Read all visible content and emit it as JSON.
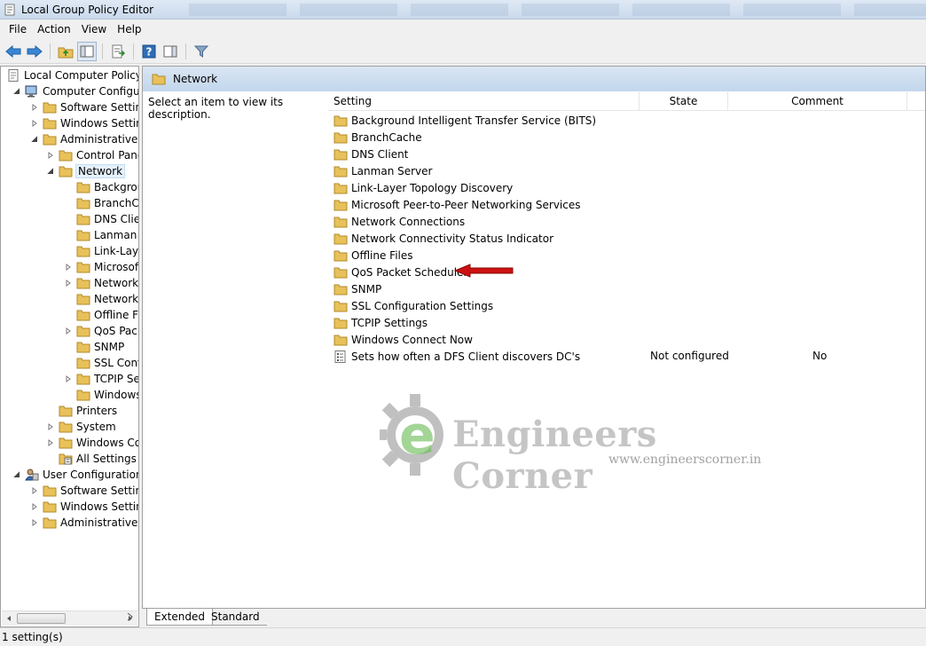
{
  "window": {
    "title": "Local Group Policy Editor"
  },
  "menu": [
    "File",
    "Action",
    "View",
    "Help"
  ],
  "tree": {
    "items": [
      {
        "label": "Local Computer Policy",
        "level": 0,
        "icon": "policy-icon",
        "expander": "none"
      },
      {
        "label": "Computer Configura",
        "level": 1,
        "icon": "computer-icon",
        "expander": "expanded"
      },
      {
        "label": "Software Settings",
        "level": 2,
        "icon": "folder-icon",
        "expander": "collapsed"
      },
      {
        "label": "Windows Setting",
        "level": 2,
        "icon": "folder-icon",
        "expander": "collapsed"
      },
      {
        "label": "Administrative Te",
        "level": 2,
        "icon": "folder-icon",
        "expander": "expanded"
      },
      {
        "label": "Control Panel",
        "level": 3,
        "icon": "folder-icon",
        "expander": "collapsed"
      },
      {
        "label": "Network",
        "level": 3,
        "icon": "folder-open-icon",
        "expander": "expanded",
        "selected": true
      },
      {
        "label": "Backgrou",
        "level": 4,
        "icon": "folder-icon",
        "expander": "none"
      },
      {
        "label": "BranchCa",
        "level": 4,
        "icon": "folder-icon",
        "expander": "none"
      },
      {
        "label": "DNS Clien",
        "level": 4,
        "icon": "folder-icon",
        "expander": "none"
      },
      {
        "label": "Lanman S",
        "level": 4,
        "icon": "folder-icon",
        "expander": "none"
      },
      {
        "label": "Link-Laye",
        "level": 4,
        "icon": "folder-icon",
        "expander": "none"
      },
      {
        "label": "Microsoft",
        "level": 4,
        "icon": "folder-icon",
        "expander": "collapsed"
      },
      {
        "label": "Network C",
        "level": 4,
        "icon": "folder-icon",
        "expander": "collapsed"
      },
      {
        "label": "Network C",
        "level": 4,
        "icon": "folder-icon",
        "expander": "none"
      },
      {
        "label": "Offline Fil",
        "level": 4,
        "icon": "folder-icon",
        "expander": "none"
      },
      {
        "label": "QoS Packe",
        "level": 4,
        "icon": "folder-icon",
        "expander": "collapsed"
      },
      {
        "label": "SNMP",
        "level": 4,
        "icon": "folder-icon",
        "expander": "none"
      },
      {
        "label": "SSL Confi",
        "level": 4,
        "icon": "folder-icon",
        "expander": "none"
      },
      {
        "label": "TCPIP Set",
        "level": 4,
        "icon": "folder-icon",
        "expander": "collapsed"
      },
      {
        "label": "Windows",
        "level": 4,
        "icon": "folder-icon",
        "expander": "none"
      },
      {
        "label": "Printers",
        "level": 3,
        "icon": "folder-icon",
        "expander": "none"
      },
      {
        "label": "System",
        "level": 3,
        "icon": "folder-icon",
        "expander": "collapsed"
      },
      {
        "label": "Windows Cor",
        "level": 3,
        "icon": "folder-icon",
        "expander": "collapsed"
      },
      {
        "label": "All Settings",
        "level": 3,
        "icon": "all-settings-icon",
        "expander": "none"
      },
      {
        "label": "User Configuration",
        "level": 1,
        "icon": "user-icon",
        "expander": "expanded"
      },
      {
        "label": "Software Settings",
        "level": 2,
        "icon": "folder-icon",
        "expander": "collapsed"
      },
      {
        "label": "Windows Setting",
        "level": 2,
        "icon": "folder-icon",
        "expander": "collapsed"
      },
      {
        "label": "Administrative Te",
        "level": 2,
        "icon": "folder-icon",
        "expander": "collapsed"
      }
    ]
  },
  "right": {
    "header_title": "Network",
    "description": "Select an item to view its description.",
    "columns": [
      "Setting",
      "State",
      "Comment"
    ],
    "rows": [
      {
        "name": "Background Intelligent Transfer Service (BITS)",
        "icon": "folder-icon",
        "state": "",
        "comment": ""
      },
      {
        "name": "BranchCache",
        "icon": "folder-icon",
        "state": "",
        "comment": ""
      },
      {
        "name": "DNS Client",
        "icon": "folder-icon",
        "state": "",
        "comment": ""
      },
      {
        "name": "Lanman Server",
        "icon": "folder-icon",
        "state": "",
        "comment": ""
      },
      {
        "name": "Link-Layer Topology Discovery",
        "icon": "folder-icon",
        "state": "",
        "comment": ""
      },
      {
        "name": "Microsoft Peer-to-Peer Networking Services",
        "icon": "folder-icon",
        "state": "",
        "comment": ""
      },
      {
        "name": "Network Connections",
        "icon": "folder-icon",
        "state": "",
        "comment": ""
      },
      {
        "name": "Network Connectivity Status Indicator",
        "icon": "folder-icon",
        "state": "",
        "comment": ""
      },
      {
        "name": "Offline Files",
        "icon": "folder-icon",
        "state": "",
        "comment": ""
      },
      {
        "name": "QoS Packet Scheduler",
        "icon": "folder-icon",
        "state": "",
        "comment": ""
      },
      {
        "name": "SNMP",
        "icon": "folder-icon",
        "state": "",
        "comment": ""
      },
      {
        "name": "SSL Configuration Settings",
        "icon": "folder-icon",
        "state": "",
        "comment": ""
      },
      {
        "name": "TCPIP Settings",
        "icon": "folder-icon",
        "state": "",
        "comment": ""
      },
      {
        "name": "Windows Connect Now",
        "icon": "folder-icon",
        "state": "",
        "comment": ""
      },
      {
        "name": "Sets how often a DFS Client discovers DC's",
        "icon": "policy-setting-icon",
        "state": "Not configured",
        "comment": "No"
      }
    ]
  },
  "tabs": [
    {
      "label": "Extended",
      "active": true
    },
    {
      "label": "Standard",
      "active": false
    }
  ],
  "status": {
    "text": "1 setting(s)"
  },
  "watermark": {
    "main": "Engineers Corner",
    "letter": "e",
    "url": "www.engineerscorner.in"
  },
  "colors": {
    "folder": "#e8c15a",
    "accent_blue": "#2f6db5",
    "arrow_red": "#cc1111",
    "header_bg": "#c9d9ec"
  }
}
